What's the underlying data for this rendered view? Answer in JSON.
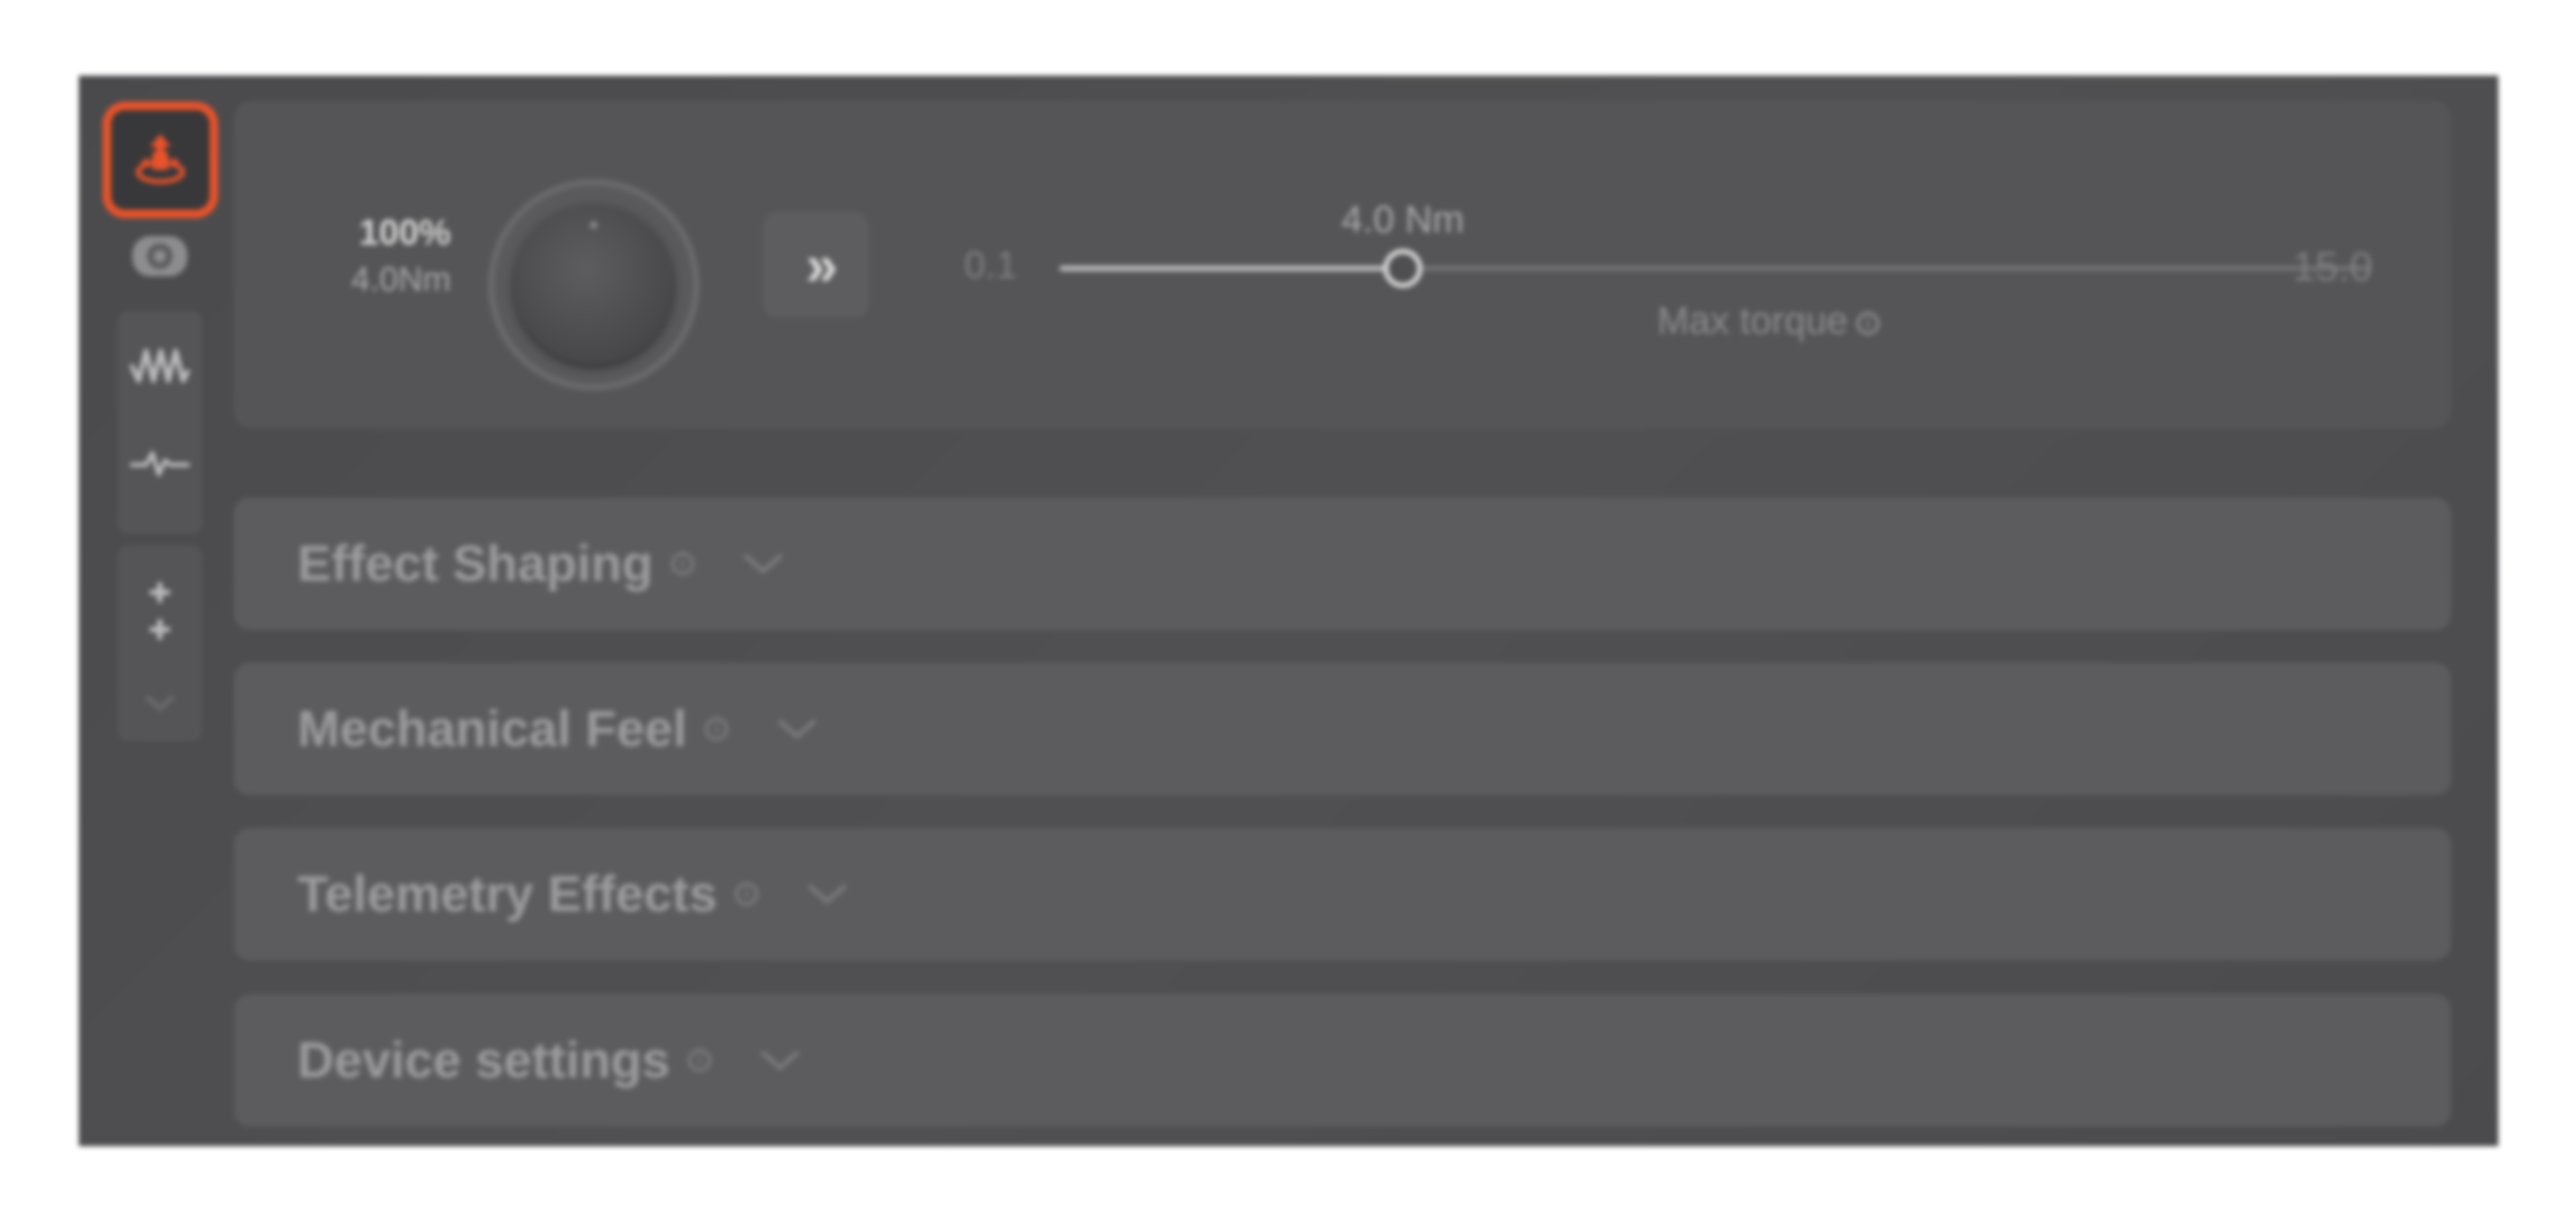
{
  "rail": {
    "items": [
      {
        "icon": "motor-upload-icon",
        "active": true,
        "accent": "#e9532b"
      },
      {
        "icon": "wheel-icon"
      },
      {
        "icon": "waveform-icon"
      },
      {
        "icon": "pulse-icon"
      },
      {
        "icon": "more-dots-icon"
      },
      {
        "icon": "chevron-down-icon"
      }
    ]
  },
  "torque": {
    "percent": "100%",
    "current_nm": "4.0Nm",
    "boost_glyph": "»",
    "min_label": "0.1",
    "max_label": "15.0",
    "value_label": "4.0 Nm",
    "value": 4.0,
    "min": 0.1,
    "max": 15.0,
    "caption": "Max torque"
  },
  "sections": [
    {
      "title": "Effect Shaping"
    },
    {
      "title": "Mechanical Feel"
    },
    {
      "title": "Telemetry Effects"
    },
    {
      "title": "Device settings"
    }
  ],
  "colors": {
    "accent": "#e9532b",
    "panel": "#555557",
    "section": "#5c5c5e"
  }
}
